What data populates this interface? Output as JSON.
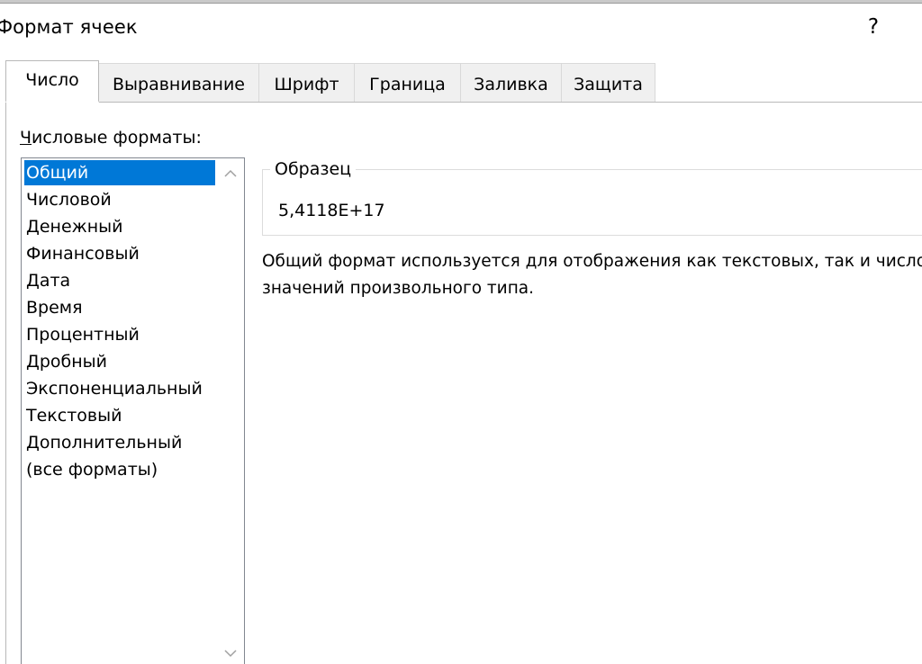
{
  "dialog": {
    "title": "Формат ячеек",
    "help_label": "?"
  },
  "tabs": [
    {
      "label": "Число",
      "active": true
    },
    {
      "label": "Выравнивание",
      "active": false
    },
    {
      "label": "Шрифт",
      "active": false
    },
    {
      "label": "Граница",
      "active": false
    },
    {
      "label": "Заливка",
      "active": false
    },
    {
      "label": "Защита",
      "active": false
    }
  ],
  "number_tab": {
    "category_label_first_letter": "Ч",
    "category_label_rest": "исловые форматы:",
    "categories": [
      "Общий",
      "Числовой",
      "Денежный",
      "Финансовый",
      "Дата",
      "Время",
      "Процентный",
      "Дробный",
      "Экспоненциальный",
      "Текстовый",
      "Дополнительный",
      "(все форматы)"
    ],
    "selected_category": "Общий",
    "sample_legend": "Образец",
    "sample_value": "5,4118E+17",
    "description_line1": "Общий формат используется для отображения как текстовых, так и числовых",
    "description_line2": "значений произвольного типа."
  },
  "colors": {
    "selection": "#0078d7",
    "tab_inactive": "#f0f0f0",
    "border": "#b9b9b9"
  },
  "icons": {
    "scroll_up": "chevron-up-icon",
    "scroll_down": "chevron-down-icon"
  }
}
